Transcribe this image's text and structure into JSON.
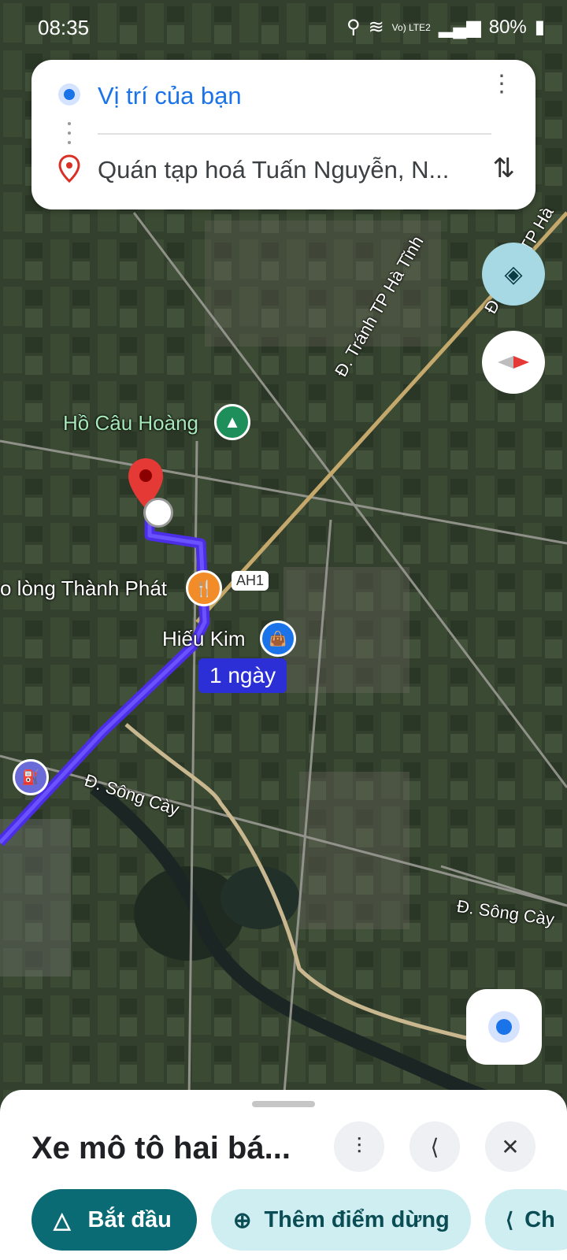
{
  "status": {
    "time": "08:35",
    "battery": "80%",
    "signal": "Vo) LTE2"
  },
  "directions": {
    "origin": "Vị trí của bạn",
    "destination": "Quán tạp hoá Tuấn Nguyễn, N..."
  },
  "map": {
    "labels": {
      "lake": "Hồ Câu Hoàng",
      "restaurant": "o lòng Thành Phát",
      "shop": "Hiếu Kim",
      "highway": "AH1",
      "road_bypass": "Đ. Tránh TP Hà Tĩnh",
      "road_right": "Đ. Tránh TP Hà",
      "road_song_cay_1": "Đ. Sông Cày",
      "road_song_cay_2": "Đ. Sông Cày"
    },
    "duration_badge": "1 ngày",
    "route_color": "#4b2ee6"
  },
  "sheet": {
    "title": "Xe mô tô hai bá...",
    "start_label": "Bắt đầu",
    "add_stop_label": "Thêm điểm dừng",
    "share_label": "Ch"
  },
  "colors": {
    "accent": "#0b6b74",
    "light_pill": "#cfeef2",
    "blue": "#1a73e8"
  }
}
